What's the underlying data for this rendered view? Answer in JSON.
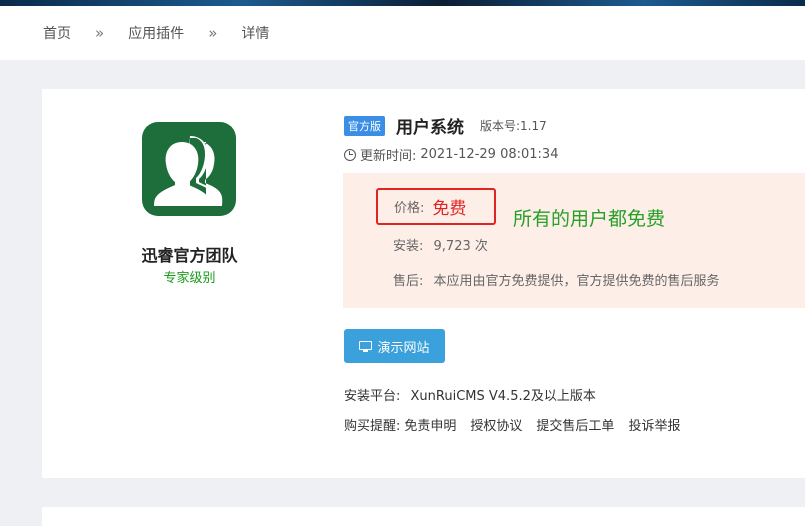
{
  "breadcrumb": {
    "home": "首页",
    "plugins": "应用插件",
    "current": "详情",
    "separator": "»"
  },
  "author": {
    "name": "迅睿官方团队",
    "level": "专家级别"
  },
  "app": {
    "badge": "官方版",
    "title": "用户系统",
    "version_label": "版本号:",
    "version": "1.17",
    "update_label": "更新时间:",
    "update_time": "2021-12-29 08:01:34"
  },
  "pricing": {
    "price_label": "价格:",
    "price_value": "免费",
    "annotation": "所有的用户都免费",
    "install_label": "安装:",
    "install_value": "9,723 次",
    "service_label": "售后:",
    "service_value": "本应用由官方免费提供，官方提供免费的售后服务"
  },
  "demo_button": "演示网站",
  "platform": {
    "label": "安装平台:",
    "value": "XunRuiCMS V4.5.2及以上版本"
  },
  "remind": {
    "label": "购买提醒:",
    "links": [
      "免责申明",
      "授权协议",
      "提交售后工单",
      "投诉举报"
    ]
  },
  "colors": {
    "accent": "#3ba1dc",
    "badge": "#3a8ee6",
    "logo_bg": "#1e6e3b",
    "price": "#e02424",
    "annotation": "#27a027",
    "level": "#1a9a1a"
  },
  "icons": {
    "clock": "clock-icon",
    "monitor": "monitor-icon",
    "logo": "users-icon"
  }
}
